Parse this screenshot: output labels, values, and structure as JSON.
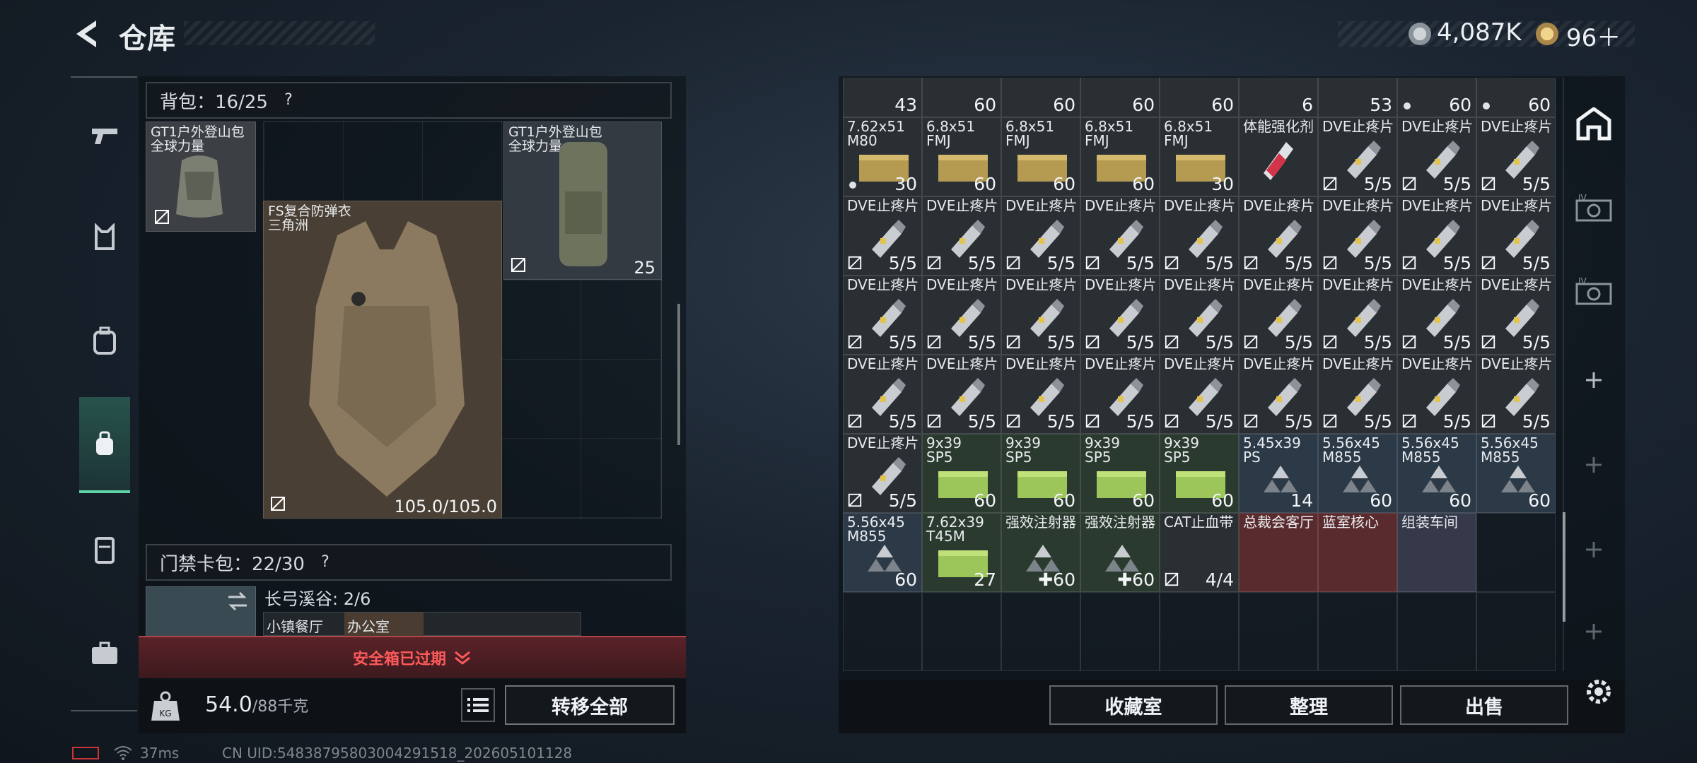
{
  "header": {
    "title": "仓库"
  },
  "currency": {
    "silver": "4,087K",
    "gold": "96＋"
  },
  "backpack": {
    "label": "背包：16/25",
    "q": "?",
    "items": [
      {
        "name": "GT1户外登山包\n全球力量",
        "kind": "pack-small"
      },
      {
        "name": "FS复合防弹衣\n三角洲",
        "durability": "105.0/105.0"
      },
      {
        "name": "GT1户外登山包\n全球力量",
        "count": "25"
      }
    ]
  },
  "keycard": {
    "label": "门禁卡包：22/30",
    "q": "?",
    "area": "长弓溪谷: 2/6",
    "slots": [
      "小镇餐厅",
      "办公室"
    ]
  },
  "safebox": {
    "status": "安全箱已过期"
  },
  "weight": {
    "value": "54.0",
    "max": "/88千克"
  },
  "actions": {
    "transfer_all": "转移全部",
    "collection": "收藏室",
    "organize": "整理",
    "sell": "出售"
  },
  "footer": {
    "ping": "37ms",
    "uid": "CN UID:54838795803004291518_202605101128"
  },
  "stash": {
    "top_row": [
      {
        "ct": "43"
      },
      {
        "ct": "60"
      },
      {
        "ct": "60"
      },
      {
        "ct": "60"
      },
      {
        "ct": "60"
      },
      {
        "ct": "6"
      },
      {
        "ct": "53"
      },
      {
        "ct": "60",
        "dot": true
      },
      {
        "ct": "60",
        "dot": true
      }
    ],
    "rows": [
      [
        {
          "nm": "7.62x51\nM80",
          "ct": "30",
          "dot": true
        },
        {
          "nm": "6.8x51\nFMJ",
          "ct": "60"
        },
        {
          "nm": "6.8x51\nFMJ",
          "ct": "60"
        },
        {
          "nm": "6.8x51\nFMJ",
          "ct": "60"
        },
        {
          "nm": "6.8x51\nFMJ",
          "ct": "30"
        },
        {
          "nm": "体能强化剂",
          "ct": ""
        },
        {
          "nm": "DVE止疼片",
          "ct": "5/5",
          "lock": true
        },
        {
          "nm": "DVE止疼片",
          "ct": "5/5",
          "lock": true
        },
        {
          "nm": "DVE止疼片",
          "ct": "5/5",
          "lock": true
        }
      ],
      [
        {
          "nm": "DVE止疼片",
          "ct": "5/5",
          "lock": true
        },
        {
          "nm": "DVE止疼片",
          "ct": "5/5",
          "lock": true
        },
        {
          "nm": "DVE止疼片",
          "ct": "5/5",
          "lock": true
        },
        {
          "nm": "DVE止疼片",
          "ct": "5/5",
          "lock": true
        },
        {
          "nm": "DVE止疼片",
          "ct": "5/5",
          "lock": true
        },
        {
          "nm": "DVE止疼片",
          "ct": "5/5",
          "lock": true
        },
        {
          "nm": "DVE止疼片",
          "ct": "5/5",
          "lock": true
        },
        {
          "nm": "DVE止疼片",
          "ct": "5/5",
          "lock": true
        },
        {
          "nm": "DVE止疼片",
          "ct": "5/5",
          "lock": true
        }
      ],
      [
        {
          "nm": "DVE止疼片",
          "ct": "5/5",
          "lock": true
        },
        {
          "nm": "DVE止疼片",
          "ct": "5/5",
          "lock": true
        },
        {
          "nm": "DVE止疼片",
          "ct": "5/5",
          "lock": true
        },
        {
          "nm": "DVE止疼片",
          "ct": "5/5",
          "lock": true
        },
        {
          "nm": "DVE止疼片",
          "ct": "5/5",
          "lock": true
        },
        {
          "nm": "DVE止疼片",
          "ct": "5/5",
          "lock": true
        },
        {
          "nm": "DVE止疼片",
          "ct": "5/5",
          "lock": true
        },
        {
          "nm": "DVE止疼片",
          "ct": "5/5",
          "lock": true
        },
        {
          "nm": "DVE止疼片",
          "ct": "5/5",
          "lock": true
        }
      ],
      [
        {
          "nm": "DVE止疼片",
          "ct": "5/5",
          "lock": true
        },
        {
          "nm": "DVE止疼片",
          "ct": "5/5",
          "lock": true
        },
        {
          "nm": "DVE止疼片",
          "ct": "5/5",
          "lock": true
        },
        {
          "nm": "DVE止疼片",
          "ct": "5/5",
          "lock": true
        },
        {
          "nm": "DVE止疼片",
          "ct": "5/5",
          "lock": true
        },
        {
          "nm": "DVE止疼片",
          "ct": "5/5",
          "lock": true
        },
        {
          "nm": "DVE止疼片",
          "ct": "5/5",
          "lock": true
        },
        {
          "nm": "DVE止疼片",
          "ct": "5/5",
          "lock": true
        },
        {
          "nm": "DVE止疼片",
          "ct": "5/5",
          "lock": true
        }
      ],
      [
        {
          "nm": "DVE止疼片",
          "ct": "5/5",
          "lock": true
        },
        {
          "nm": "9x39\nSP5",
          "ct": "60",
          "cls": "green"
        },
        {
          "nm": "9x39\nSP5",
          "ct": "60",
          "cls": "green"
        },
        {
          "nm": "9x39\nSP5",
          "ct": "60",
          "cls": "green"
        },
        {
          "nm": "9x39\nSP5",
          "ct": "60",
          "cls": "green"
        },
        {
          "nm": "5.45x39\nPS",
          "ct": "14",
          "cls": "blue"
        },
        {
          "nm": "5.56x45\nM855",
          "ct": "60",
          "cls": "blue"
        },
        {
          "nm": "5.56x45\nM855",
          "ct": "60",
          "cls": "blue"
        },
        {
          "nm": "5.56x45\nM855",
          "ct": "60",
          "cls": "blue"
        }
      ],
      [
        {
          "nm": "5.56x45\nM855",
          "ct": "60",
          "cls": "blue"
        },
        {
          "nm": "7.62x39\nT45M",
          "ct": "27",
          "cls": "green"
        },
        {
          "nm": "强效注射器",
          "ct": "✚60",
          "cls": "green"
        },
        {
          "nm": "强效注射器",
          "ct": "✚60",
          "cls": "green"
        },
        {
          "nm": "CAT止血带",
          "ct": "4/4",
          "lock": true
        },
        {
          "nm": "总裁会客厅",
          "ct": "",
          "cls": "red"
        },
        {
          "nm": "蓝室核心",
          "ct": "",
          "cls": "red"
        },
        {
          "nm": "组装车间",
          "ct": "",
          "cls": "purple"
        },
        {
          "nm": "",
          "ct": "",
          "cls": "empty"
        }
      ]
    ]
  },
  "colors": {
    "accent": "#5fd3a6",
    "expired": "#ff5a5a"
  }
}
